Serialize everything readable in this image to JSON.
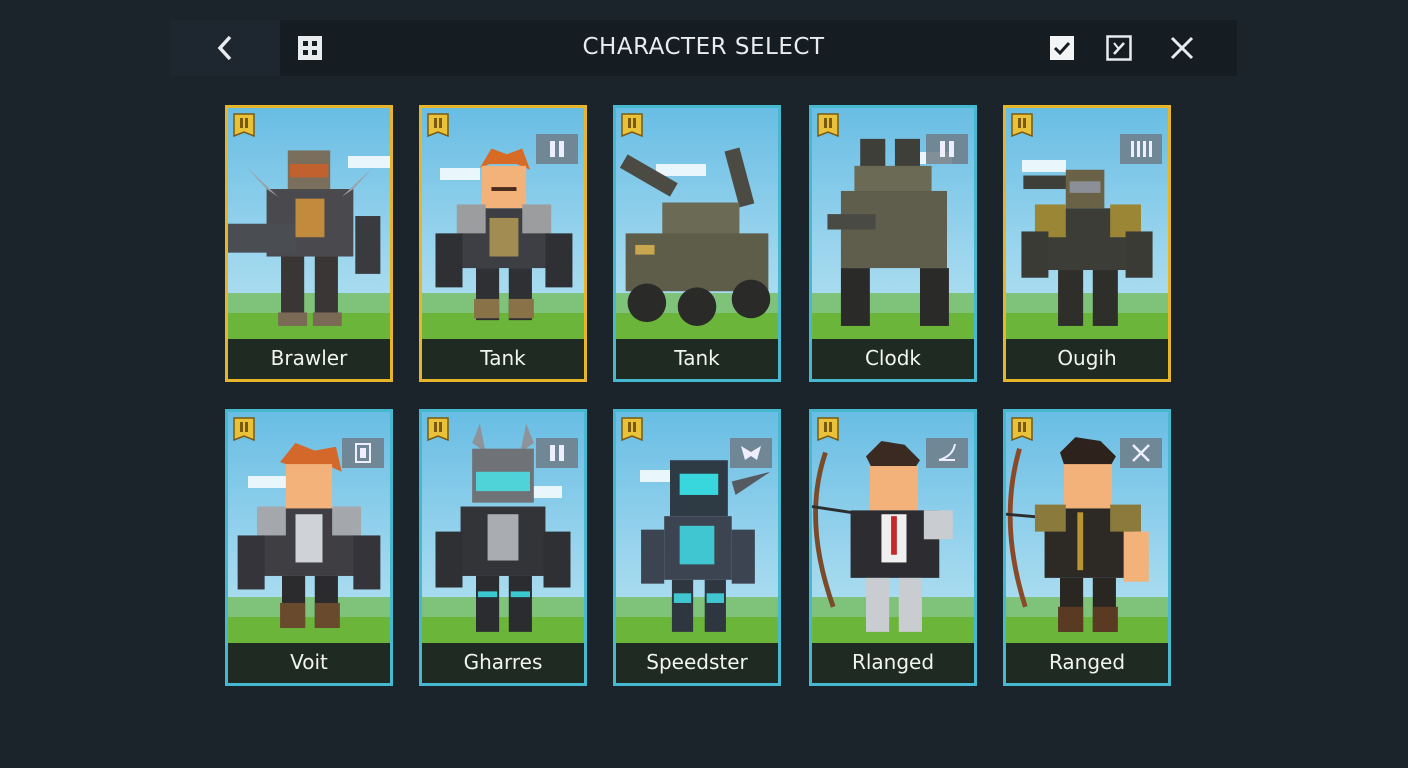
{
  "header": {
    "title": "CHARACTER SELECT"
  },
  "colors": {
    "background": "#1c242b",
    "gold_frame": "#e6b52a",
    "blue_frame": "#46b8d0",
    "label_bar": "#1f2b22"
  },
  "icons": {
    "back": "chevron-left-icon",
    "grid": "grid-icon",
    "confirm": "checkbox-icon",
    "edit": "edit-icon",
    "close": "close-icon"
  },
  "characters": [
    {
      "name": "Brawler",
      "frame": "gold",
      "class_icon": ""
    },
    {
      "name": "Tank",
      "frame": "gold",
      "class_icon": "ammo-icon"
    },
    {
      "name": "Tank",
      "frame": "blue",
      "class_icon": ""
    },
    {
      "name": "Clodk",
      "frame": "blue",
      "class_icon": "ammo-icon"
    },
    {
      "name": "Ougih",
      "frame": "gold",
      "class_icon": "bars-icon"
    },
    {
      "name": "Voit",
      "frame": "blue",
      "class_icon": "shield-icon"
    },
    {
      "name": "Gharres",
      "frame": "blue",
      "class_icon": "ammo-icon"
    },
    {
      "name": "Speedster",
      "frame": "blue",
      "class_icon": "wing-icon"
    },
    {
      "name": "Rlanged",
      "frame": "blue",
      "class_icon": "bow-icon"
    },
    {
      "name": "Ranged",
      "frame": "blue",
      "class_icon": "crossed-swords-icon"
    }
  ]
}
